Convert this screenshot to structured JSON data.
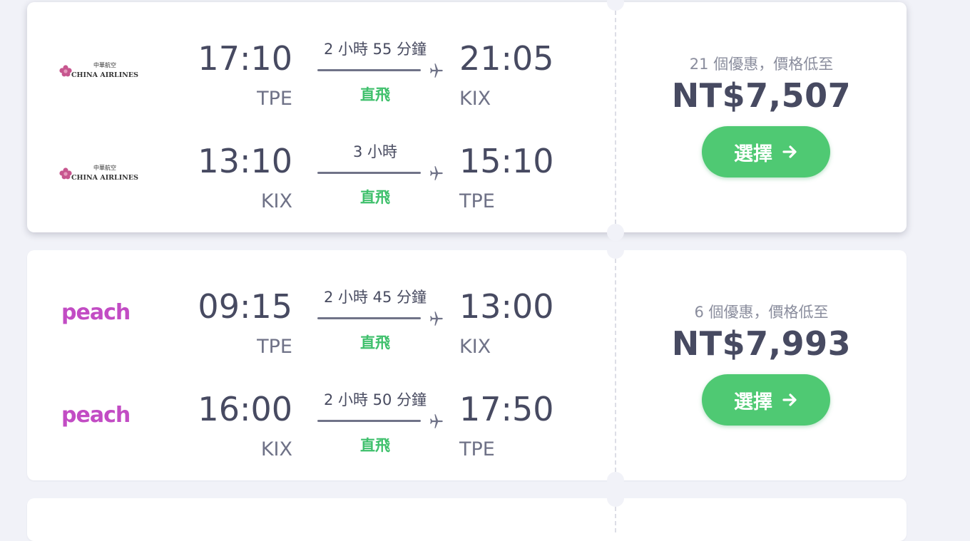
{
  "colors": {
    "accent_green": "#4fc973",
    "stops_green": "#3fc06c",
    "text_dark": "#474a61",
    "peach_brand": "#c24cc4",
    "china_airlines_brand": "#c7568f"
  },
  "results": [
    {
      "legs": [
        {
          "airline": "China Airlines",
          "logo_cn": "中華航空",
          "logo_en": "CHINA AIRLINES",
          "logo_icon": "plum-blossom-icon",
          "depart_time": "17:10",
          "depart_code": "TPE",
          "duration": "2 小時 55 分鐘",
          "stops": "直飛",
          "arrive_time": "21:05",
          "arrive_code": "KIX"
        },
        {
          "airline": "China Airlines",
          "logo_cn": "中華航空",
          "logo_en": "CHINA AIRLINES",
          "logo_icon": "plum-blossom-icon",
          "depart_time": "13:10",
          "depart_code": "KIX",
          "duration": "3 小時",
          "stops": "直飛",
          "arrive_time": "15:10",
          "arrive_code": "TPE"
        }
      ],
      "deals": "21 個優惠，價格低至",
      "price": "NT$7,507",
      "select_label": "選擇"
    },
    {
      "legs": [
        {
          "airline": "Peach",
          "logo_word": "peach",
          "depart_time": "09:15",
          "depart_code": "TPE",
          "duration": "2 小時 45 分鐘",
          "stops": "直飛",
          "arrive_time": "13:00",
          "arrive_code": "KIX"
        },
        {
          "airline": "Peach",
          "logo_word": "peach",
          "depart_time": "16:00",
          "depart_code": "KIX",
          "duration": "2 小時 50 分鐘",
          "stops": "直飛",
          "arrive_time": "17:50",
          "arrive_code": "TPE"
        }
      ],
      "deals": "6 個優惠，價格低至",
      "price": "NT$7,993",
      "select_label": "選擇"
    }
  ]
}
